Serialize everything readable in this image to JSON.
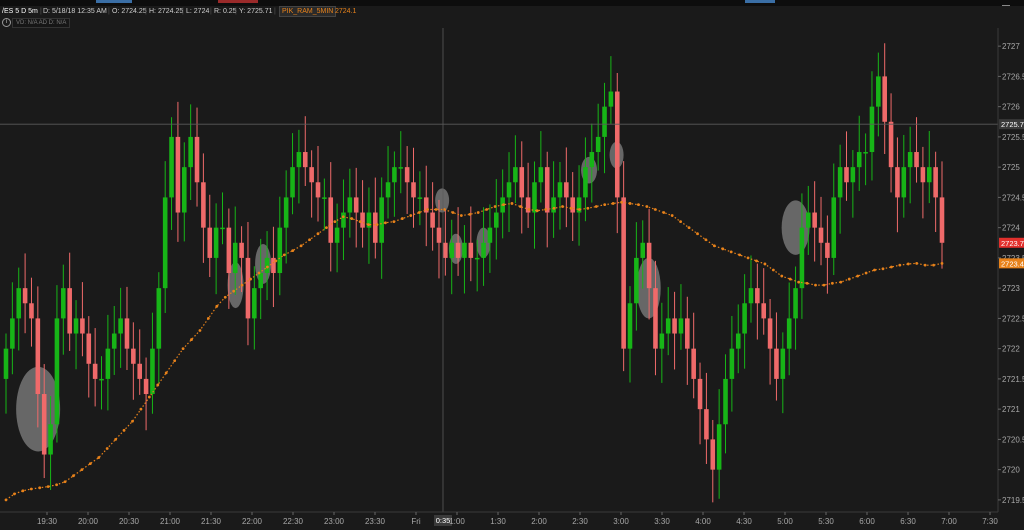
{
  "header": {
    "symbol": "/ES 5 D 5m",
    "date": "D: 5/18/18 12:35 AM",
    "open": "O: 2724.25",
    "high": "H: 2724.25",
    "low": "L: 2724",
    "range": "R: 0.25",
    "y_value": "Y: 2725.71",
    "study_name": "PIK_RAM_5MIN",
    "study_value": "2724.1"
  },
  "indicator_row": {
    "info_icon": "info-icon",
    "labels": "VD: N/A  AD D: N/A"
  },
  "colors": {
    "background": "#1a1a1a",
    "up_candle": "#17b517",
    "down_candle": "#ef6a6a",
    "moving_average": "#e8821a",
    "highlight_ellipse": "#a8a8a8",
    "last_price_tag": "#e2302c",
    "ma_tag": "#e8821a",
    "crosshair_tag": "#3a3a3a"
  },
  "chart_data": {
    "type": "candlestick",
    "title": "",
    "ylim": [
      2719.3,
      2727.3
    ],
    "y_ticks": [
      2719.5,
      2720,
      2720.5,
      2721,
      2721.5,
      2722,
      2722.5,
      2723,
      2723.5,
      2724,
      2724.5,
      2725,
      2725.5,
      2726,
      2726.5,
      2727
    ],
    "x_tick_labels": [
      "19:30",
      "20:00",
      "20:30",
      "21:00",
      "21:30",
      "22:00",
      "22:30",
      "23:00",
      "23:30",
      "Fri",
      "1:00",
      "1:30",
      "2:00",
      "2:30",
      "3:00",
      "3:30",
      "4:00",
      "4:30",
      "5:00",
      "5:30",
      "6:00",
      "6:30",
      "7:00",
      "7:30"
    ],
    "crosshair_x_label": "0:35",
    "crosshair_y_label": "2725.71",
    "last_price": "2723.75",
    "ma_last": "2723.41",
    "closes": [
      2722,
      2722.5,
      2723,
      2722.75,
      2722.5,
      2721.25,
      2720.25,
      2720.75,
      2722.5,
      2723,
      2722.25,
      2722.5,
      2722.25,
      2721.75,
      2721.5,
      2721.5,
      2722,
      2722.25,
      2722.5,
      2722,
      2721.75,
      2721.5,
      2721.25,
      2722,
      2723,
      2724.5,
      2725.5,
      2724.25,
      2725,
      2725.5,
      2724.75,
      2724,
      2723.5,
      2724,
      2724,
      2723.25,
      2723.75,
      2723.5,
      2722.5,
      2723,
      2723.25,
      2723.5,
      2723.25,
      2724,
      2724.5,
      2725,
      2725.25,
      2725,
      2724.75,
      2724.5,
      2724.5,
      2723.75,
      2724,
      2724.25,
      2724.5,
      2724.25,
      2724,
      2724.25,
      2723.75,
      2724.5,
      2724.75,
      2725,
      2725,
      2724.75,
      2724.5,
      2724.5,
      2724.25,
      2724,
      2723.75,
      2723.5,
      2723.75,
      2723.5,
      2723.75,
      2723.5,
      2723.5,
      2723.75,
      2724,
      2724.25,
      2724.5,
      2724.75,
      2725,
      2724.5,
      2724.25,
      2724.75,
      2725,
      2724.25,
      2724.5,
      2724.75,
      2724.5,
      2724.25,
      2724.5,
      2725,
      2725.25,
      2725.5,
      2726,
      2726.25,
      2724.5,
      2722,
      2722.75,
      2723.5,
      2723.75,
      2723,
      2722,
      2722.25,
      2722.5,
      2722.25,
      2722.5,
      2722,
      2721.5,
      2721,
      2720.5,
      2720,
      2720.75,
      2721.5,
      2722,
      2722.25,
      2722.75,
      2723,
      2722.75,
      2722.5,
      2722,
      2721.5,
      2722,
      2722.5,
      2723,
      2724,
      2724.25,
      2724,
      2723.75,
      2723.5,
      2724.5,
      2725,
      2724.75,
      2725,
      2725.25,
      2725.25,
      2726,
      2726.5,
      2725.75,
      2725,
      2724.5,
      2725,
      2725.25,
      2725,
      2724.75,
      2725,
      2724.5,
      2723.75
    ],
    "moving_average": {
      "name": "PIK_RAM_5MIN",
      "values": [
        2719.5,
        2719.6,
        2719.65,
        2719.68,
        2719.7,
        2719.72,
        2719.75,
        2719.8,
        2719.9,
        2720,
        2720.1,
        2720.2,
        2720.35,
        2720.5,
        2720.65,
        2720.8,
        2721,
        2721.2,
        2721.4,
        2721.6,
        2721.8,
        2722,
        2722.15,
        2722.3,
        2722.5,
        2722.7,
        2722.85,
        2722.95,
        2723.05,
        2723.15,
        2723.25,
        2723.35,
        2723.45,
        2723.55,
        2723.62,
        2723.7,
        2723.8,
        2723.9,
        2724,
        2724.1,
        2724.18,
        2724.15,
        2724.1,
        2724.05,
        2724.05,
        2724.08,
        2724.1,
        2724.15,
        2724.2,
        2724.25,
        2724.3,
        2724.3,
        2724.3,
        2724.25,
        2724.2,
        2724.22,
        2724.25,
        2724.3,
        2724.35,
        2724.38,
        2724.4,
        2724.35,
        2724.3,
        2724.28,
        2724.3,
        2724.32,
        2724.35,
        2724.32,
        2724.3,
        2724.32,
        2724.35,
        2724.38,
        2724.4,
        2724.42,
        2724.4,
        2724.38,
        2724.35,
        2724.3,
        2724.25,
        2724.2,
        2724.1,
        2724,
        2723.9,
        2723.8,
        2723.7,
        2723.65,
        2723.6,
        2723.55,
        2723.5,
        2723.45,
        2723.4,
        2723.3,
        2723.2,
        2723.15,
        2723.1,
        2723.08,
        2723.05,
        2723.05,
        2723.08,
        2723.1,
        2723.15,
        2723.2,
        2723.25,
        2723.3,
        2723.32,
        2723.35,
        2723.38,
        2723.4,
        2723.41,
        2723.38,
        2723.38,
        2723.41
      ]
    }
  }
}
